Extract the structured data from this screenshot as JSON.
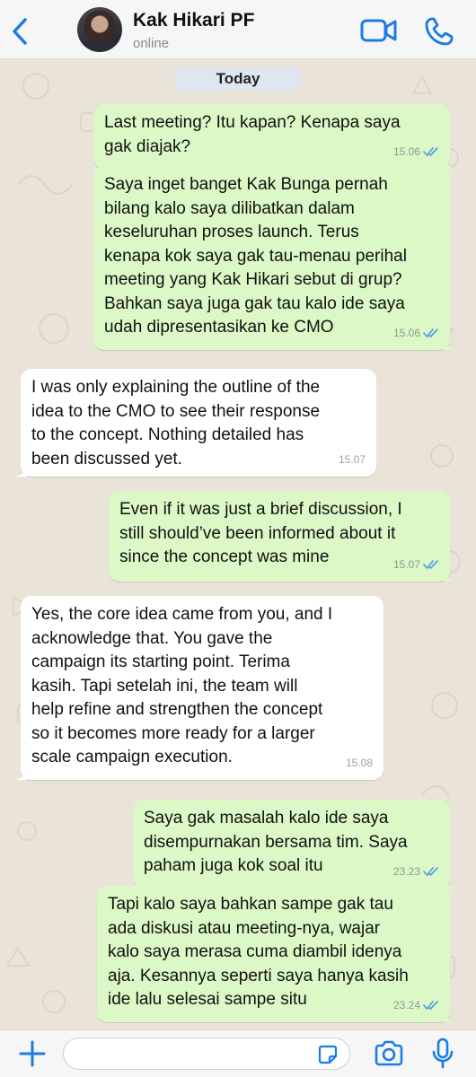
{
  "header": {
    "contact_name": "Kak Hikari PF",
    "status": "online",
    "icons": [
      "back-chevron-icon",
      "video-call-icon",
      "phone-call-icon"
    ],
    "accent_color": "#1a7ce5"
  },
  "chat": {
    "date_label": "Today",
    "colors": {
      "outgoing_bubble": "#dcf8c6",
      "incoming_bubble": "#ffffff",
      "wallpaper": "#e9e3d8",
      "read_ticks": "#4fa3e0"
    },
    "messages": [
      {
        "direction": "outgoing",
        "text": "Last meeting? Itu kapan? Kenapa saya\ngak diajak?",
        "time": "15.06",
        "status": "read"
      },
      {
        "direction": "outgoing",
        "text": "Saya inget banget Kak Bunga pernah\nbilang kalo saya dilibatkan dalam\nkeseluruhan proses launch. Terus\nkenapa kok saya gak tau-menau perihal\nmeeting yang Kak Hikari sebut di grup?\nBahkan saya juga gak tau kalo ide saya\nudah dipresentasikan ke CMO",
        "time": "15.06",
        "status": "read"
      },
      {
        "direction": "incoming",
        "text": "I was only explaining the outline of the\nidea to the CMO to see their response\nto the concept. Nothing detailed has\nbeen discussed yet.",
        "time": "15.07"
      },
      {
        "direction": "outgoing",
        "text": "Even if it was just a brief discussion, I\nstill should’ve been informed about it\nsince the concept was mine",
        "time": "15.07",
        "status": "read"
      },
      {
        "direction": "incoming",
        "text": "Yes, the core idea came from you, and I\nacknowledge that. You gave the\ncampaign its starting point. Terima\nkasih. Tapi setelah ini, the team will\nhelp refine and strengthen the concept\nso it becomes more ready for a larger\nscale campaign execution.",
        "time": "15.08"
      },
      {
        "direction": "outgoing",
        "text": "Saya gak masalah kalo ide saya\ndisempurnakan bersama tim. Saya\npaham juga kok soal itu",
        "time": "23.23",
        "status": "read"
      },
      {
        "direction": "outgoing",
        "text": "Tapi kalo saya bahkan sampe gak tau\nada diskusi atau meeting-nya, wajar\nkalo saya merasa cuma diambil idenya\naja. Kesannya seperti saya hanya kasih\nide lalu selesai sampe situ",
        "time": "23.24",
        "status": "read"
      }
    ]
  },
  "composer": {
    "icons": [
      "plus-icon",
      "sticker-icon",
      "camera-icon",
      "microphone-icon"
    ]
  }
}
